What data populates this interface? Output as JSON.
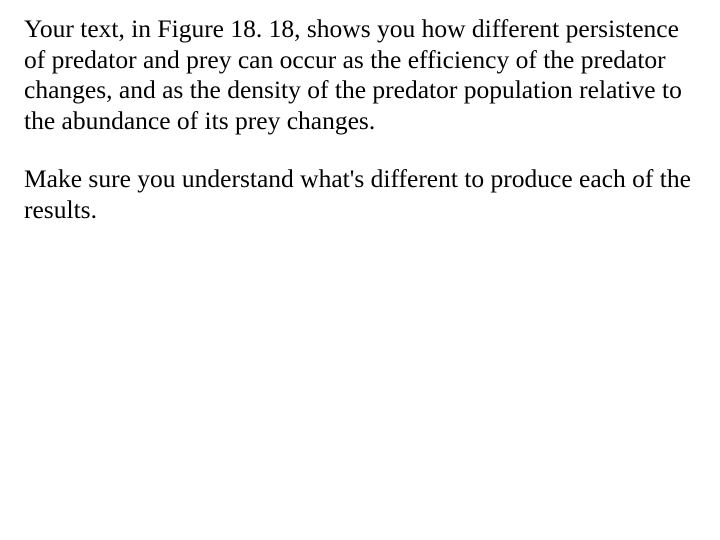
{
  "paragraphs": {
    "p1": "Your text, in Figure 18. 18, shows you how different persistence of predator and prey can occur as the efficiency of the predator changes, and as the density of the predator population relative to the abundance of its prey changes.",
    "p2": "Make sure you understand what's different to produce each of the results."
  }
}
